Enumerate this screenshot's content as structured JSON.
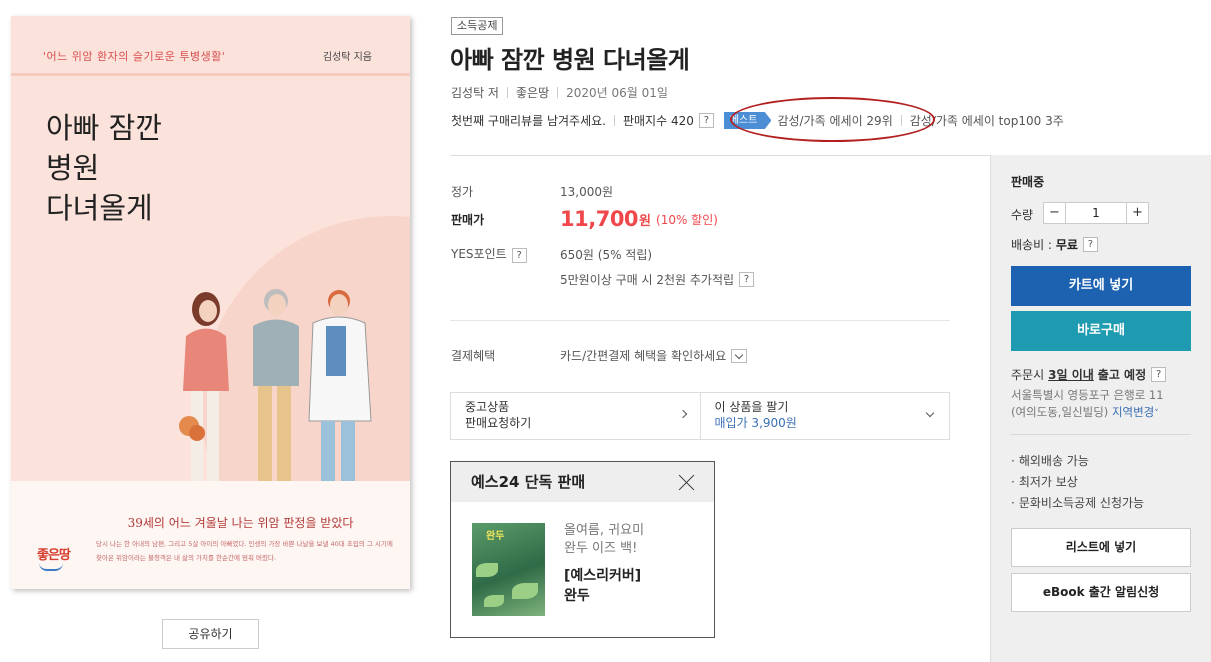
{
  "cover": {
    "tagline": "'어느 위암 환자의 슬기로운 투병생활'",
    "author": "김성탁 지음",
    "title": "아빠 잠깐\n병원\n다녀올게",
    "headline": "39세의 어느 겨울날 나는 위암 판정을 받았다",
    "body": "당시 나는 한 아내의 남편, 그리고 5살 아이의 아빠였다. 인생의 가장 바쁜 나날을 보낼 40대 초입의 그 시기에 찾아온 위암이라는 불청객은 내 삶의 가치를 한순간에 멈춰 버렸다.",
    "logo": "좋은땅"
  },
  "share_label": "공유하기",
  "badge": "소득공제",
  "title": "아빠 잠깐 병원 다녀올게",
  "meta": {
    "author": "김성탁 저",
    "publisher": "좋은땅",
    "date": "2020년 06월 01일"
  },
  "meta2": {
    "review": "첫번째 구매리뷰를 남겨주세요.",
    "sales_index": "판매지수 420",
    "q": "?",
    "best_tag": "베스트",
    "best_rank": "감성/가족 에세이 29위",
    "top100": "감성/가족 에세이 top100 3주"
  },
  "price": {
    "list_label": "정가",
    "list_value": "13,000원",
    "sale_label": "판매가",
    "sale_value": "11,700",
    "sale_unit": "원",
    "discount": "(10% 할인)",
    "points_label": "YES포인트",
    "points_value": "650원 (5% 적립)",
    "points_extra": "5만원이상 구매 시 2천원 추가적립"
  },
  "payment": {
    "label": "결제혜택",
    "value": "카드/간편결제 혜택을 확인하세요"
  },
  "used": {
    "left_line1": "중고상품",
    "left_line2": "판매요청하기",
    "right_line1": "이 상품을 팔기",
    "right_line2": "매입가 3,900원"
  },
  "exclusive": {
    "header": "예스24 단독 판매",
    "thumb_title": "완두",
    "sub": "올여름, 귀요미\n완두 이즈 백!",
    "name": "[예스리커버]\n완두"
  },
  "panel": {
    "status": "판매중",
    "qty_label": "수량",
    "qty_value": "1",
    "minus": "−",
    "plus": "+",
    "ship_label": "배송비 :",
    "ship_value": "무료",
    "cart": "카트에 넣기",
    "buy": "바로구매",
    "ship_pre": "주문시",
    "ship_days": "3일 이내",
    "ship_post": "출고 예정",
    "addr_line1": "서울특별시 영등포구 은행로 11",
    "addr_line2": "(여의도동,일신빌딩)",
    "region_change": "지역변경",
    "features": [
      "해외배송 가능",
      "최저가 보상",
      "문화비소득공제 신청가능"
    ],
    "wishlist": "리스트에 넣기",
    "ebook": "eBook 출간 알림신청"
  },
  "colors": {
    "price_red": "#f0474b",
    "cart_blue": "#1c62b0",
    "buy_teal": "#1e9bb0",
    "best_blue": "#4b8ed6",
    "annotation_red": "#b32020"
  }
}
